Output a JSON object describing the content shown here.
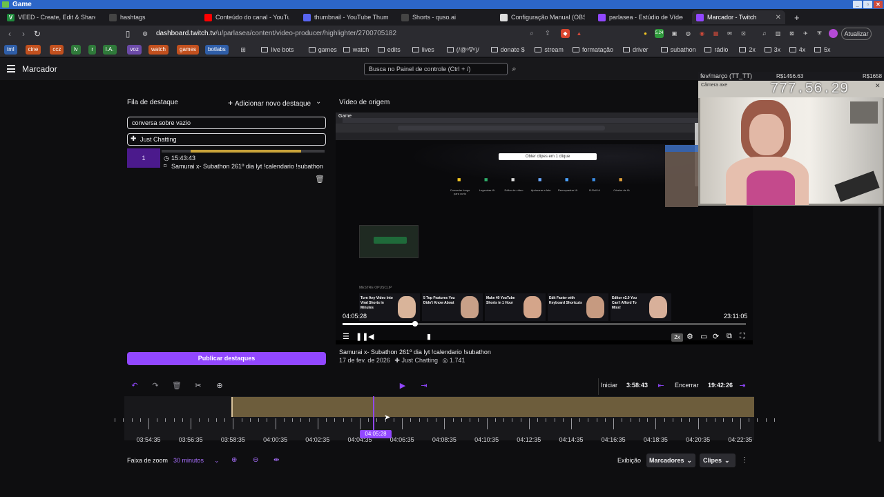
{
  "os": {
    "title": "Game"
  },
  "tabs": [
    {
      "label": "VEED - Create, Edit & Share Vi",
      "color": "#1f8a3c",
      "glyph": "V"
    },
    {
      "label": "hashtags",
      "color": "#444",
      "glyph": ""
    },
    {
      "label": "Conteúdo do canal - YouTube",
      "color": "#ff0000",
      "glyph": ""
    },
    {
      "label": "thumbnail - YouTube Thumbn",
      "color": "#5865f2",
      "glyph": ""
    },
    {
      "label": "Shorts - quso.ai",
      "color": "#444",
      "glyph": ""
    },
    {
      "label": "Configuração Manual (OBS Ve",
      "color": "#ddd",
      "glyph": ""
    },
    {
      "label": "parlasea - Estúdio de Vídeo - T",
      "color": "#9147ff",
      "glyph": ""
    },
    {
      "label": "Marcador - Twitch",
      "color": "#9147ff",
      "glyph": ""
    }
  ],
  "address": {
    "domain": "dashboard.twitch.tv",
    "path": "/u/parlasea/content/video-producer/highlighter/2700705182",
    "update_label": "Atualizar"
  },
  "bookmarks": {
    "pills": [
      {
        "label": "tml",
        "color": "#2f5ea8"
      },
      {
        "label": "cine",
        "color": "#c2501e"
      },
      {
        "label": "ccz",
        "color": "#c2501e"
      },
      {
        "label": "lv",
        "color": "#2f7a3a"
      },
      {
        "label": "r",
        "color": "#2f7a3a"
      },
      {
        "label": "I.A.",
        "color": "#2f7a3a"
      },
      {
        "label": "voz",
        "color": "#6b4aa8"
      },
      {
        "label": "watch",
        "color": "#c2501e"
      },
      {
        "label": "games",
        "color": "#c2501e"
      },
      {
        "label": "botlabs",
        "color": "#2f5ea8"
      }
    ],
    "folders": [
      "live bots",
      "games",
      "watch",
      "edits",
      "lives",
      "(/@ᵒ∇ᵒ)/",
      "donate $",
      "stream",
      "formatação",
      "driver",
      "subathon",
      "rádio",
      "2x",
      "3x",
      "4x",
      "5x"
    ]
  },
  "header": {
    "title": "Marcador",
    "search_placeholder": "Busca no Painel de controle (Ctrl + /)"
  },
  "queue": {
    "title": "Fila de destaque",
    "add_label": "Adicionar novo destaque",
    "title_value": "conversa sobre vazio",
    "category_value": "Just Chatting",
    "clip": {
      "number": "1",
      "time": "15:43:43",
      "title": "Samurai x- Subathon 261º dia lyt !calendario !subathon"
    },
    "publish_label": "Publicar destaques"
  },
  "video": {
    "title": "Vídeo de origem",
    "inner_tab": "Game",
    "inner_button": "Obter clipes em 1 clique",
    "inner_tiles": [
      "Converter longo para curto",
      "Legendas IA",
      "Editor de vídeo",
      "Aprimorar a fala",
      "Reenquadrar IA",
      "B-Roll IA",
      "Criador de IA"
    ],
    "inner_section": "MESTRE OPUSCLIP",
    "inner_thumbs": [
      "Turn Any Video Into Viral Shorts in Minutes",
      "5 Top Features You Didn't Know About",
      "Make 40 YouTube Shorts in 1 Hour",
      "Edit Faster with Keyboard Shortcuts",
      "Editor v2.0 You Can't Afford To Miss!"
    ],
    "current_time": "04:05:28",
    "duration": "23:11:05",
    "progress": 0.18,
    "speed": "2x",
    "meta_title": "Samurai x- Subathon 261º dia lyt !calendario !subathon",
    "date": "17 de fev. de 2026",
    "category": "Just Chatting",
    "views": "1.741"
  },
  "overlay": {
    "title": "fev/março (TT_TT)",
    "value1": "R$1456.63",
    "value2": "R$1658",
    "counter": "777.56.29",
    "cam_label": "Câmera axe"
  },
  "timeline": {
    "start_label": "Iniciar",
    "start_value": "3:58:43",
    "end_label": "Encerrar",
    "end_value": "19:42:26",
    "playhead": "04:05:28",
    "ticks": [
      "03:54:35",
      "03:56:35",
      "03:58:35",
      "04:00:35",
      "04:02:35",
      "04:04:35",
      "04:06:35",
      "04:08:35",
      "04:10:35",
      "04:12:35",
      "04:14:35",
      "04:16:35",
      "04:18:35",
      "04:20:35",
      "04:22:35"
    ],
    "zoom_label": "Faixa de zoom",
    "zoom_value": "30 minutos",
    "view_label": "Exibição",
    "markers_label": "Marcadores",
    "clips_label": "Clipes"
  }
}
